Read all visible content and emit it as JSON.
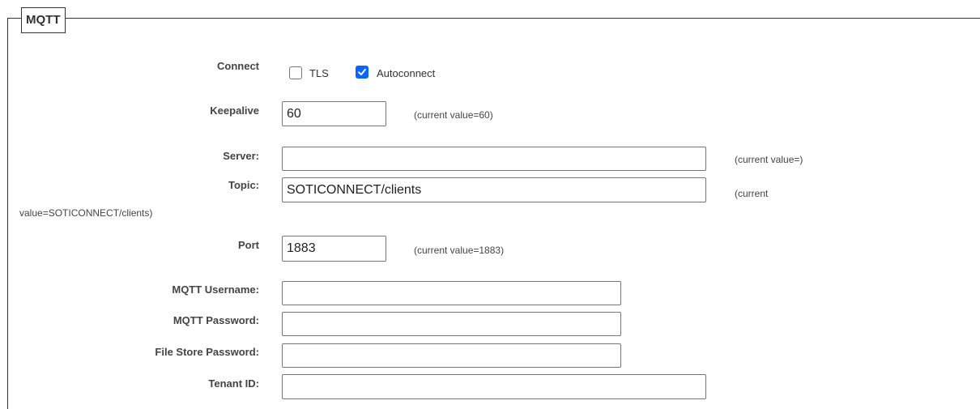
{
  "legend": "MQTT",
  "connect": {
    "label": "Connect",
    "tls": {
      "label": "TLS",
      "checked": false
    },
    "autoconnect": {
      "label": "Autoconnect",
      "checked": true
    }
  },
  "keepalive": {
    "label": "Keepalive",
    "value": "60",
    "current": "(current value=60)"
  },
  "server": {
    "label": "Server:",
    "value": "",
    "current": "(current value=)"
  },
  "topic": {
    "label": "Topic:",
    "value": "SOTICONNECT/clients",
    "current_part1": "(current",
    "current_part2": "value=SOTICONNECT/clients)"
  },
  "port": {
    "label": "Port",
    "value": "1883",
    "current": "(current value=1883)"
  },
  "mqtt_username": {
    "label": "MQTT Username:",
    "value": ""
  },
  "mqtt_password": {
    "label": "MQTT Password:",
    "value": ""
  },
  "file_store_password": {
    "label": "File Store Password:",
    "value": ""
  },
  "tenant_id": {
    "label": "Tenant ID:",
    "value": ""
  }
}
